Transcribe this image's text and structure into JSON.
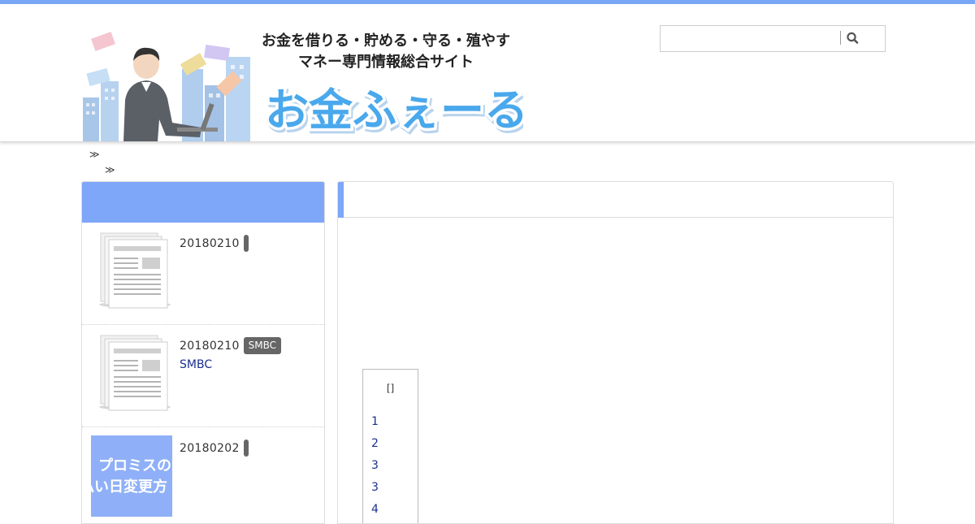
{
  "site": {
    "tagline_line1": "お金を借りる・貯める・守る・殖やす",
    "tagline_line2": "マネー専門情報総合サイト",
    "logo_text": "お金ふぇーる"
  },
  "search": {
    "placeholder": "",
    "value": ""
  },
  "breadcrumb": {
    "sep1": "≫",
    "sep2": "≫"
  },
  "sidebar": {
    "items": [
      {
        "date": "20180210",
        "badge": "",
        "link": "",
        "thumb": "document-icon"
      },
      {
        "date": "20180210",
        "badge": "SMBC",
        "link": "SMBC",
        "thumb": "document-icon"
      },
      {
        "date": "20180202",
        "badge": "",
        "link": "",
        "thumb": "promise-thumbnail",
        "thumb_text1": "プロミスの",
        "thumb_text2": "払い日変更方"
      }
    ]
  },
  "toc": {
    "title": "[]",
    "items": [
      "1",
      "2",
      "3",
      "3",
      "4"
    ]
  },
  "colors": {
    "accent": "#7ea6f9",
    "topbar": "#7aa7f5",
    "link": "#1a2f8f"
  }
}
